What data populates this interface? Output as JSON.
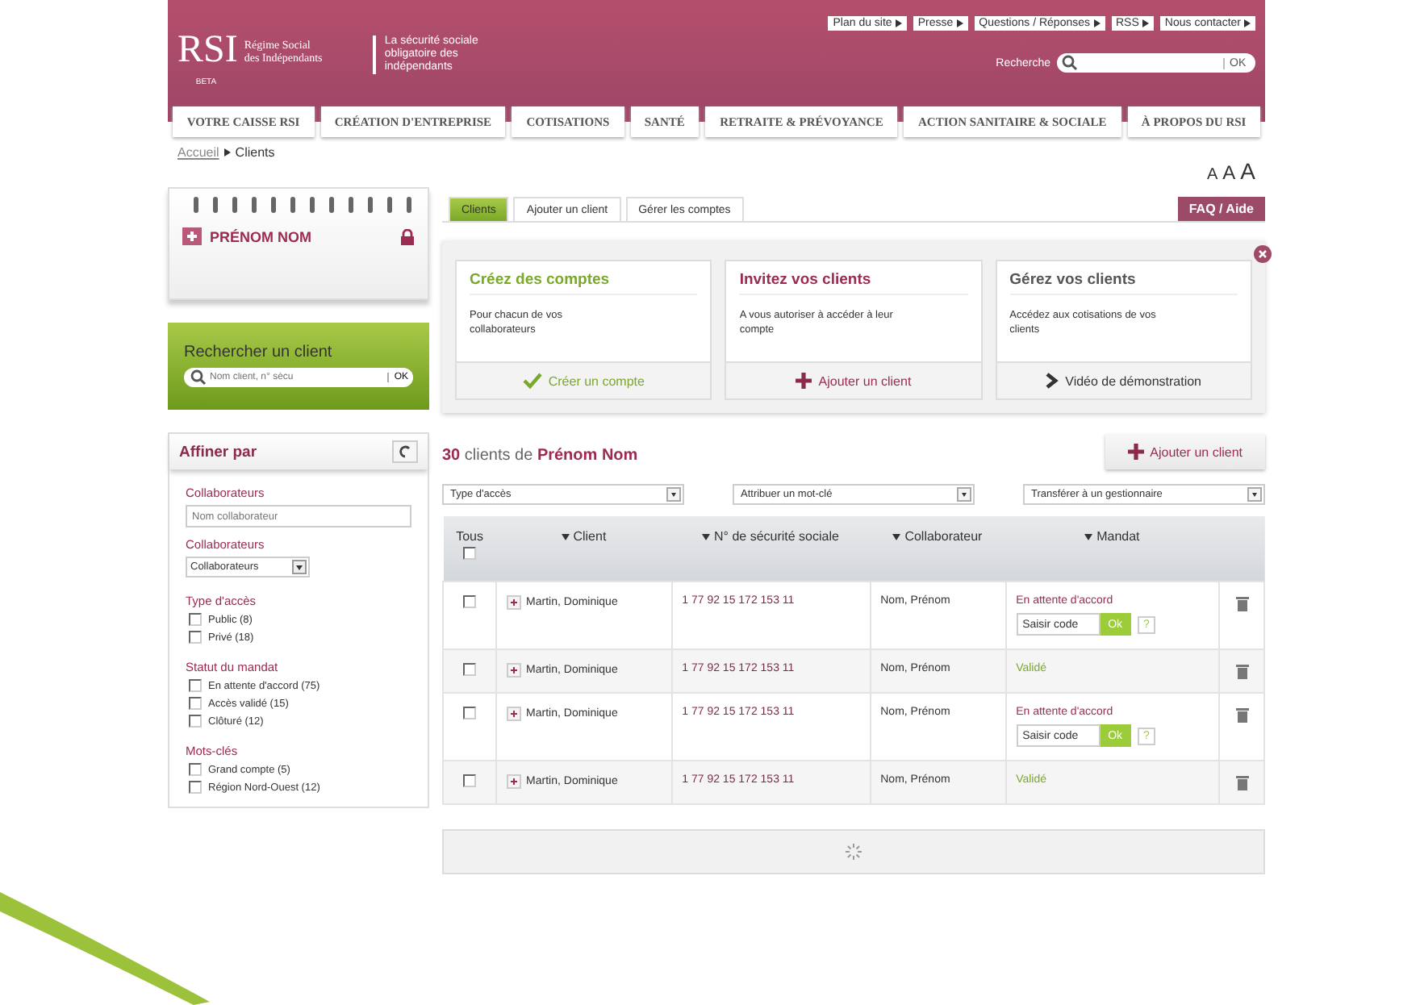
{
  "header": {
    "logo": "RSI",
    "logo_sub": "Régime Social des Indépendants",
    "logo_beta": "BETA",
    "tagline": "La sécurité sociale obligatoire des indépendants",
    "top_links": [
      "Plan du site",
      "Presse",
      "Questions / Réponses",
      "RSS",
      "Nous contacter"
    ],
    "search": {
      "label": "Recherche",
      "button": "OK"
    }
  },
  "nav": [
    {
      "label": "VOTRE CAISSE RSI",
      "selected": false
    },
    {
      "label": "CRÉATION D'ENTREPRISE",
      "selected": false
    },
    {
      "label": "COTISATIONS",
      "selected": false
    },
    {
      "label": "SANTÉ",
      "selected": false
    },
    {
      "label": "RETRAITE & PRÉVOYANCE",
      "selected": false
    },
    {
      "label": "ACTION SANITAIRE & SOCIALE",
      "selected": false
    },
    {
      "label": "À PROPOS DU RSI",
      "selected": false
    }
  ],
  "breadcrumb": [
    "Accueil",
    "Clients"
  ],
  "font_sizes": [
    "A",
    "A",
    "A"
  ],
  "sidebar": {
    "user": "PRÉNOM NOM",
    "search": {
      "title": "Rechercher un client",
      "placeholder": "Nom client, n° sécu",
      "button": "OK"
    },
    "filter": {
      "title": "Affiner par",
      "sections": [
        {
          "kind": "text",
          "title": "Collaborateurs",
          "placeholder": "Nom collaborateur"
        },
        {
          "kind": "select",
          "title": "Collaborateurs",
          "value": "Collaborateurs"
        },
        {
          "kind": "checks",
          "title": "Type d'accès",
          "options": [
            {
              "label": "Public (8)",
              "checked": false
            },
            {
              "label": "Privé (18)",
              "checked": false
            }
          ]
        },
        {
          "kind": "checks",
          "title": "Statut du mandat",
          "options": [
            {
              "label": "En attente d'accord (75)",
              "checked": false
            },
            {
              "label": "Accès validé (15)",
              "checked": false
            },
            {
              "label": "Clôturé (12)",
              "checked": false
            }
          ]
        },
        {
          "kind": "checks",
          "title": "Mots-clés",
          "options": [
            {
              "label": "Grand compte (5)",
              "checked": false
            },
            {
              "label": "Région Nord-Ouest (12)",
              "checked": false
            }
          ]
        }
      ]
    }
  },
  "tabs": [
    {
      "label": "Clients",
      "selected": true
    },
    {
      "label": "Ajouter un client",
      "selected": false
    },
    {
      "label": "Gérer les comptes",
      "selected": false
    }
  ],
  "help_button": "FAQ / Aide",
  "cards": [
    {
      "kind": "create",
      "title": "Créez des comptes",
      "text": "Pour chacun de vos collaborateurs",
      "action": "Créer un compte"
    },
    {
      "kind": "invite",
      "title": "Invitez vos clients",
      "text": "A vous autoriser à accéder à leur compte",
      "action": "Ajouter un client"
    },
    {
      "kind": "manage",
      "title": "Gérez vos clients",
      "text": "Accédez aux cotisations de vos clients",
      "action": "Vidéo de démonstration"
    }
  ],
  "list": {
    "count": "30",
    "count_text": "clients de",
    "owner": "Prénom Nom",
    "add_button": "Ajouter un client",
    "actions": [
      "Type d'accès",
      "Attribuer un mot-clé",
      "Transférer à un gestionnaire"
    ],
    "all_label": "Tous",
    "all_checked": false,
    "columns": [
      "Client",
      "N° de sécurité sociale",
      "Collaborateur",
      "Mandat"
    ],
    "rows": [
      {
        "checked": false,
        "client": "Martin, Dominique",
        "ssn": "1 77 92 15 172 153  11",
        "collaborator": "Nom, Prénom",
        "mandate": {
          "kind": "pending",
          "status": "En attente d'accord",
          "placeholder": "Saisir code",
          "ok": "Ok",
          "help": "?"
        }
      },
      {
        "checked": false,
        "client": "Martin, Dominique",
        "ssn": "1 77 92 15 172 153  11",
        "collaborator": "Nom, Prénom",
        "mandate": {
          "kind": "validated",
          "status": "Validé"
        }
      },
      {
        "checked": false,
        "client": "Martin, Dominique",
        "ssn": "1 77 92 15 172 153  11",
        "collaborator": "Nom, Prénom",
        "mandate": {
          "kind": "pending",
          "status": "En attente d'accord",
          "placeholder": "Saisir code",
          "ok": "Ok",
          "help": "?"
        }
      },
      {
        "checked": false,
        "client": "Martin, Dominique",
        "ssn": "1 77 92 15 172 153  11",
        "collaborator": "Nom, Prénom",
        "mandate": {
          "kind": "validated",
          "status": "Validé"
        }
      }
    ]
  }
}
